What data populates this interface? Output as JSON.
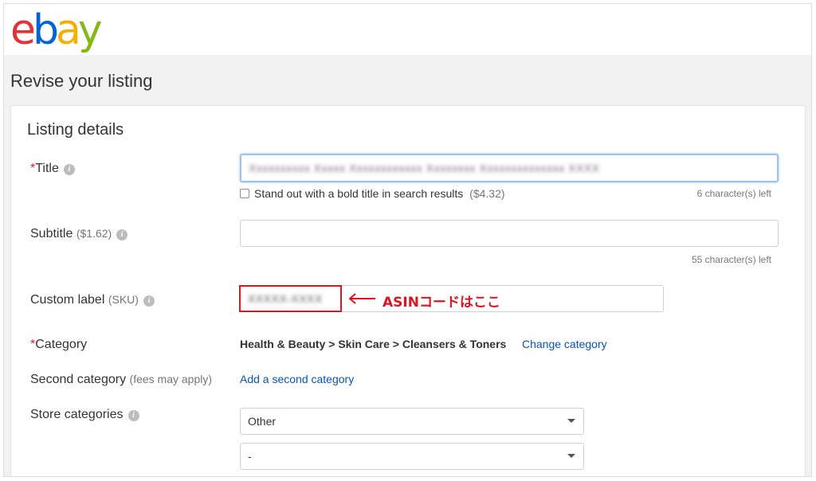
{
  "brand": {
    "logo_letters": [
      "e",
      "b",
      "a",
      "y"
    ],
    "logo_colors": [
      "#e53238",
      "#0064d2",
      "#f5af02",
      "#86b817"
    ]
  },
  "page": {
    "title": "Revise your listing"
  },
  "listing_details": {
    "section_title": "Listing details",
    "title_field": {
      "required_mark": "*",
      "label": "Title",
      "value": "Xxxxxxxxxx Xxxxx Xxxxxxxxxxxx Xxxxxxxx Xxxxxxxxxxxxxx XXXX",
      "bold_title_option": "Stand out with a bold title in search results",
      "bold_title_price": "($4.32)",
      "chars_left": "6 character(s) left"
    },
    "subtitle_field": {
      "label": "Subtitle",
      "price": "($1.62)",
      "value": "",
      "chars_left": "55 character(s) left"
    },
    "custom_label_field": {
      "label": "Custom label",
      "suffix": "(SKU)",
      "value": "XXXXX-XXXX"
    },
    "category_field": {
      "required_mark": "*",
      "label": "Category",
      "path": "Health & Beauty > Skin Care > Cleansers & Toners",
      "change_link": "Change category"
    },
    "second_category_field": {
      "label": "Second category",
      "note": "(fees may apply)",
      "add_link": "Add a second category"
    },
    "store_categories_field": {
      "label": "Store categories",
      "primary_selected": "Other",
      "secondary_selected": "-"
    }
  },
  "annotation": {
    "text": "ASINコードはここ",
    "color": "#e0141e"
  },
  "icons": {
    "info": "info-icon",
    "dropdown": "chevron-down-icon",
    "arrow": "arrow-left-icon"
  }
}
